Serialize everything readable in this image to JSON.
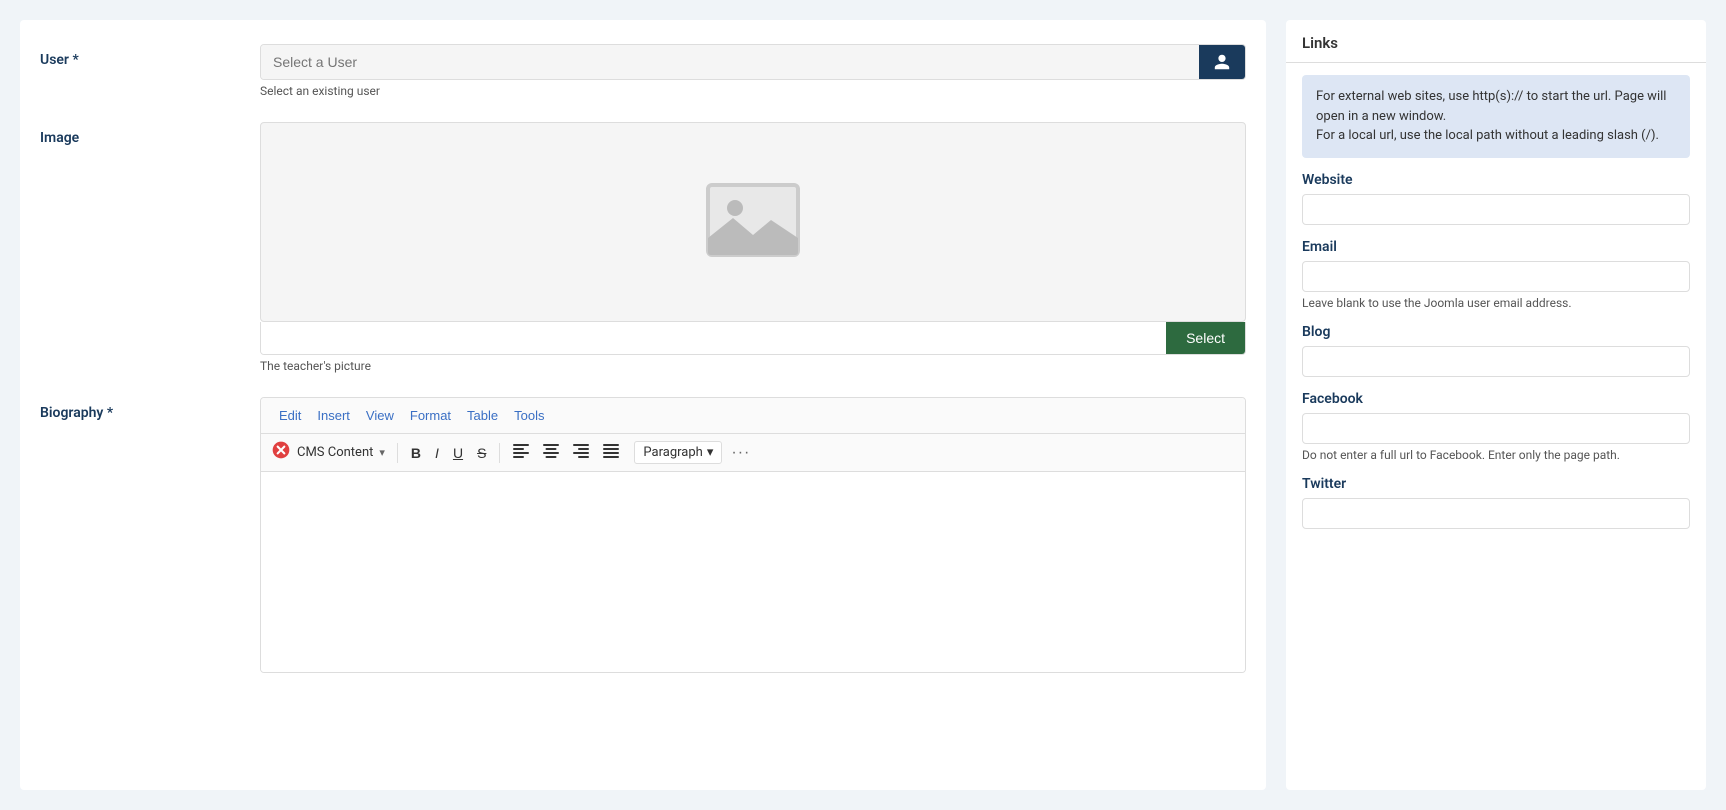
{
  "form": {
    "user_label": "User *",
    "user_placeholder": "Select a User",
    "user_hint": "Select an existing user",
    "image_label": "Image",
    "image_hint": "The teacher's picture",
    "select_button": "Select",
    "biography_label": "Biography *"
  },
  "editor": {
    "menu_items": [
      "Edit",
      "Insert",
      "View",
      "Format",
      "Table",
      "Tools"
    ],
    "brand": "CMS Content",
    "bold": "B",
    "italic": "I",
    "underline": "U",
    "strikethrough": "S",
    "paragraph_label": "Paragraph",
    "more": "···"
  },
  "sidebar": {
    "title": "Links",
    "info_text": "For external web sites, use http(s):// to start the url. Page will open in a new window.\nFor a local url, use the local path without a leading slash (/).",
    "website_label": "Website",
    "email_label": "Email",
    "email_hint": "Leave blank to use the Joomla user email address.",
    "blog_label": "Blog",
    "facebook_label": "Facebook",
    "facebook_hint": "Do not enter a full url to Facebook. Enter only the page path.",
    "twitter_label": "Twitter"
  }
}
